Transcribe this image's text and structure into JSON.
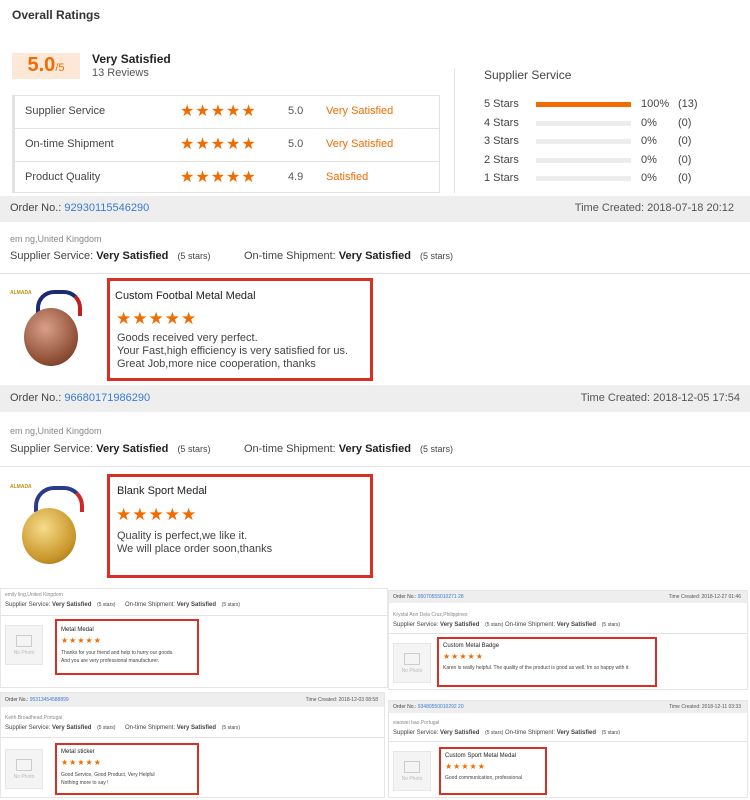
{
  "ratings": {
    "title": "Overall Ratings",
    "score": "5.0",
    "score_suffix": "/5",
    "overall_label": "Very Satisfied",
    "reviews": "13 Reviews",
    "criteria": [
      {
        "label": "Supplier Service",
        "stars": "★★★★★",
        "score": "5.0",
        "verdict": "Very Satisfied"
      },
      {
        "label": "On-time Shipment",
        "stars": "★★★★★",
        "score": "5.0",
        "verdict": "Very Satisfied"
      },
      {
        "label": "Product Quality",
        "stars": "★★★★★",
        "score": "4.9",
        "verdict": "Satisfied"
      }
    ],
    "breakdown_title": "Supplier Service",
    "breakdown": [
      {
        "label": "5 Stars",
        "pct": "100%",
        "count": "(13)",
        "fill": 1.0
      },
      {
        "label": "4 Stars",
        "pct": "0%",
        "count": "(0)",
        "fill": 0
      },
      {
        "label": "3 Stars",
        "pct": "0%",
        "count": "(0)",
        "fill": 0
      },
      {
        "label": "2 Stars",
        "pct": "0%",
        "count": "(0)",
        "fill": 0
      },
      {
        "label": "1 Stars",
        "pct": "0%",
        "count": "(0)",
        "fill": 0
      }
    ]
  },
  "orders": [
    {
      "order_label": "Order No.:",
      "order_no": "92930115546290",
      "time_label": "Time Created:",
      "time": "2018-07-18 20:12",
      "buyer": "em   ng,United Kingdom",
      "service_label": "Supplier Service:",
      "service_value": "Very Satisfied",
      "service_stars": "(5 stars)",
      "shipment_label": "On-time Shipment:",
      "shipment_value": "Very Satisfied",
      "shipment_stars": "(5 stars)",
      "product": "Custom Footbal Metal Medal",
      "review_stars": "★★★★★",
      "review": [
        "Goods received very perfect.",
        "Your Fast,high efficiency is very satisfied for us.",
        "Great Job,more nice cooperation, thanks"
      ],
      "thumb_brand": "ALMADA"
    },
    {
      "order_label": "Order No.:",
      "order_no": "96680171986290",
      "time_label": "Time Created:",
      "time": "2018-12-05 17:54",
      "buyer": "em   ng,United Kingdom",
      "service_label": "Supplier Service:",
      "service_value": "Very Satisfied",
      "service_stars": "(5 stars)",
      "shipment_label": "On-time Shipment:",
      "shipment_value": "Very Satisfied",
      "shipment_stars": "(5 stars)",
      "product": "Blank Sport Medal",
      "review_stars": "★★★★★",
      "review": [
        "Quality is perfect,we like it.",
        "We will place order soon,thanks"
      ],
      "thumb_brand": "ALMADA"
    }
  ],
  "mini": [
    {
      "order_no": "",
      "time": "",
      "buyer": "emily ling,United Kingdom",
      "service_label": "Supplier Service:",
      "service_value": "Very Satisfied",
      "service_stars": "(5 stars)",
      "shipment_label": "On-time Shipment:",
      "shipment_value": "Very Satisfied",
      "shipment_stars": "(5 stars)",
      "product": "Metal Medal",
      "review_stars": "★★★★★",
      "review": [
        "Thanks for your friend and help to hurry our goods.",
        "And you are very professional manufacturer."
      ],
      "no_photo": "No Photo"
    },
    {
      "order_label": "Order No.:",
      "order_no": "95070555010271 28",
      "time_label": "Time Created:",
      "time": "2018-12-27 01:46",
      "buyer": "Krystal Ann Dela Cruz,Philippines",
      "service_label": "Supplier Service:",
      "service_value": "Very Satisfied",
      "service_stars": "(5 stars)",
      "shipment_label": "On-time Shipment:",
      "shipment_value": "Very Satisfied",
      "shipment_stars": "(5 stars)",
      "product": "Custom Metal Badge",
      "review_stars": "★★★★★",
      "review": [
        "Karen is really helpful. The quality of the product is good as well. Im so happy with it."
      ],
      "no_photo": "No Photo"
    },
    {
      "order_label": "Order No.:",
      "order_no": "95313454588899",
      "time_label": "Time Created:",
      "time": "2018-12-03 08:58",
      "buyer": "Keith Broadhead,Portugal",
      "service_label": "Supplier Service:",
      "service_value": "Very Satisfied",
      "service_stars": "(5 stars)",
      "shipment_label": "On-time Shipment:",
      "shipment_value": "Very Satisfied",
      "shipment_stars": "(5 stars)",
      "product": "Metal sticker",
      "review_stars": "★★★★★",
      "review": [
        "Good Service, Good Product, Very Helpful",
        "Nothing more to say !"
      ],
      "no_photo": "No Photo"
    },
    {
      "order_label": "Order No.:",
      "order_no": "93480550010292 20",
      "time_label": "Time Created:",
      "time": "2018-12-11 03:33",
      "buyer": "xiaowei bao,Portugal",
      "service_label": "Supplier Service:",
      "service_value": "Very Satisfied",
      "service_stars": "(5 stars)",
      "shipment_label": "On-time Shipment:",
      "shipment_value": "Very Satisfied",
      "shipment_stars": "(5 stars)",
      "product": "Custom Sport Metal Medal",
      "review_stars": "★★★★★",
      "review": [
        "Good communication, professional"
      ],
      "no_photo": "No Photo"
    }
  ],
  "colors": {
    "accent": "#f06c00",
    "link": "#3a7bd5",
    "highlight": "#d93025"
  }
}
